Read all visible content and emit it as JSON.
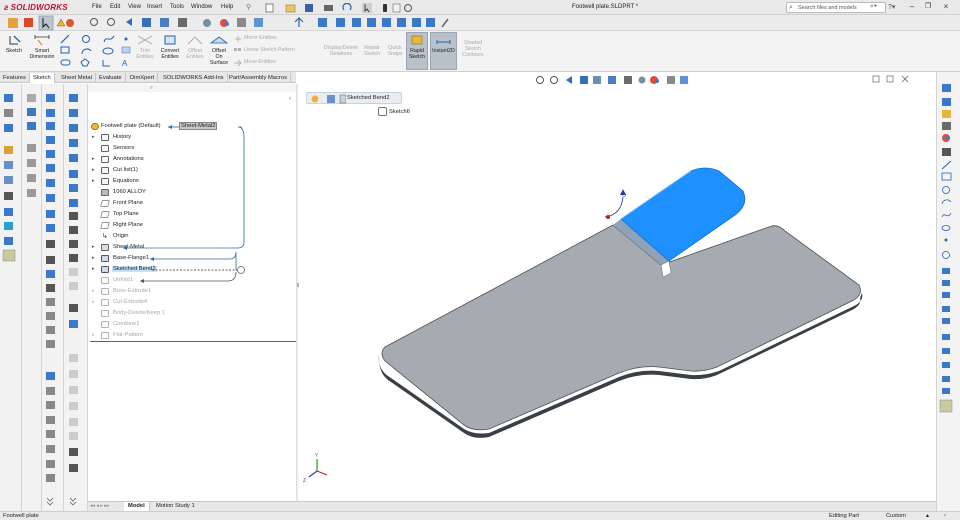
{
  "colors": {
    "accent": "#1E90FF",
    "highlight": "#C8E0F4",
    "logo": "#C8102E",
    "active_tool": "#B9C2CB"
  },
  "app": {
    "brand": "SOLIDWORKS"
  },
  "menu": [
    "File",
    "Edit",
    "View",
    "Insert",
    "Tools",
    "Window",
    "Help"
  ],
  "document_title": "Footwell plate.SLDPRT *",
  "search": {
    "placeholder": "Search files and models"
  },
  "commands": {
    "sketch": "Sketch",
    "smart_dimension": [
      "Smart",
      "Dimension"
    ],
    "trim": [
      "Trim",
      "Entities"
    ],
    "convert": [
      "Convert",
      "Entities"
    ],
    "offset": [
      "Offset",
      "Entities"
    ],
    "offset_surface": [
      "Offset",
      "On",
      "Surface"
    ],
    "mirror": "Mirror Entities",
    "linear_pattern": "Linear Sketch Pattern",
    "move": "Move Entities",
    "display_delete": [
      "Display/Delete",
      "Relations"
    ],
    "repair": [
      "Repair",
      "Sketch"
    ],
    "quick_snaps": [
      "Quick",
      "Snaps"
    ],
    "rapid": [
      "Rapid",
      "Sketch"
    ],
    "instant2d": "Instant2D",
    "shaded": [
      "Shaded",
      "Sketch",
      "Contours"
    ]
  },
  "tabs": [
    "Features",
    "Sketch",
    "Sheet Metal",
    "Evaluate",
    "DimXpert",
    "SOLIDWORKS Add-Ins",
    "Part/Assembly Macros"
  ],
  "active_tab": "Sketch",
  "tree": {
    "root": "Footwell plate  (Default)",
    "root_tag": "Sheet-Metal2",
    "items": [
      {
        "label": "History",
        "state": "normal"
      },
      {
        "label": "Sensors",
        "state": "normal"
      },
      {
        "label": "Annotations",
        "state": "normal"
      },
      {
        "label": "Cut list(1)",
        "state": "normal"
      },
      {
        "label": "Equations",
        "state": "normal"
      },
      {
        "label": "1060 ALLOY",
        "state": "normal"
      },
      {
        "label": "Front Plane",
        "state": "normal"
      },
      {
        "label": "Top Plane",
        "state": "normal"
      },
      {
        "label": "Right Plane",
        "state": "normal"
      },
      {
        "label": "Origin",
        "state": "normal"
      },
      {
        "label": "Sheet-Metal",
        "state": "normal"
      },
      {
        "label": "Base-Flange1",
        "state": "normal"
      },
      {
        "label": "Sketched Bend2",
        "state": "selected"
      },
      {
        "label": "Unfold1",
        "state": "suppressed"
      },
      {
        "label": "Boss-Extrude1",
        "state": "suppressed"
      },
      {
        "label": "Cut-Extrude4",
        "state": "suppressed"
      },
      {
        "label": "Body-Delete/Keep 1",
        "state": "suppressed"
      },
      {
        "label": "Combine1",
        "state": "suppressed"
      },
      {
        "label": "Flat-Pattern",
        "state": "suppressed"
      }
    ]
  },
  "breadcrumb": {
    "feature": "Sketched Bend2",
    "sketch": "Sketch6"
  },
  "bottom_tabs": [
    "Model",
    "Motion Study 1"
  ],
  "status": {
    "left": "Footwell plate",
    "mode": "Editing Part",
    "units": "Custom"
  },
  "triad": {
    "y": "Y",
    "z": "Z"
  }
}
